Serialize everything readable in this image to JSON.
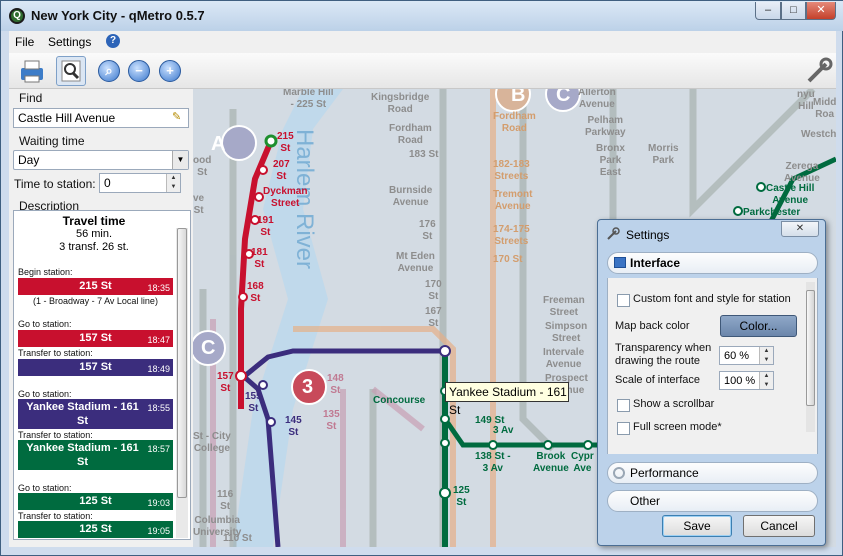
{
  "window": {
    "title": "New York City - qMetro 0.5.7",
    "app_icon": "qmetro-logo-icon",
    "minimize": "–",
    "maximize": "□",
    "close": "✕"
  },
  "menu": {
    "file": "File",
    "settings": "Settings",
    "help_icon": "help-icon"
  },
  "toolbar": {
    "print": "printer-icon",
    "find": "find-icon",
    "zoom_fit": "zoom-fit-icon",
    "zoom_out": "zoom-out-icon",
    "zoom_in": "zoom-in-icon",
    "tools": "tools-icon"
  },
  "find": {
    "label": "Find",
    "value": "Castle Hill Avenue"
  },
  "waiting": {
    "label": "Waiting time",
    "value": "Day",
    "time_label": "Time to station:",
    "time_value": "0"
  },
  "description": {
    "label": "Description",
    "heading": "Travel time",
    "duration": "56 min.",
    "summary": "3 transf. 26 st.",
    "begin_label": "Begin station:",
    "begin_station": "215 St",
    "begin_time": "18:35",
    "begin_line": "(1 - Broadway - 7 Av Local line)",
    "goto1_label": "Go to station:",
    "goto1_station": "157 St",
    "goto1_time": "18:47",
    "transfer1_label": "Transfer to station:",
    "transfer1_station": "157 St",
    "transfer1_time": "18:49",
    "goto2_label": "Go to station:",
    "goto2_station": "Yankee Stadium - 161 St",
    "goto2_time": "18:55",
    "transfer2_label": "Transfer to station:",
    "transfer2_station": "Yankee Stadium - 161 St",
    "transfer2_time": "18:57",
    "goto3_label": "Go to station:",
    "goto3_station": "125 St",
    "goto3_time": "19:03",
    "transfer3_label": "Transfer to station:",
    "transfer3_station": "125 St",
    "transfer3_time": "19:05"
  },
  "colors": {
    "red_line": "#c8102e",
    "purple_line": "#3b2d7d",
    "green_line": "#006b3f"
  },
  "map": {
    "river": "Harlem River",
    "lines": [
      "A",
      "B",
      "C",
      "C",
      "3"
    ],
    "labels": {
      "marble_hill": "Marble Hill\n- 225 St",
      "kingsbridge": "Kingsbridge\nRoad",
      "fordham1": "Fordham\nRoad",
      "st183": "183 St",
      "burnside": "Burnside\nAvenue",
      "st176": "176\nSt",
      "mt_eden": "Mt Eden\nAvenue",
      "st170": "170\nSt",
      "st167": "167\nSt",
      "st161": "161\nSt",
      "fordham2": "Fordham\nRoad",
      "st182": "182-183\nStreets",
      "tremont": "Tremont\nAvenue",
      "st174": "174-175\nStreets",
      "st170b": "170 St",
      "allerton": "Allerton\nAvenue",
      "pelham": "Pelham\nParkway",
      "bronx_park": "Bronx\nPark\nEast",
      "morris": "Morris\nPark",
      "freeman": "Freeman\nStreet",
      "simpson": "Simpson\nStreet",
      "intervale": "Intervale\nAvenue",
      "prospect": "Prospect\nAvenue",
      "st215": "215\nSt",
      "st207": "207\nSt",
      "dyckman": "Dyckman\nStreet",
      "st191": "191\nSt",
      "st181": "181\nSt",
      "st168": "168\nSt",
      "st157": "157\nSt",
      "st155": "155\nSt",
      "st145": "145\nSt",
      "st148": "148\nSt",
      "st135": "135\nSt",
      "concourse": "Concourse",
      "st149": "149 St",
      "st3av": "3 Av",
      "st138": "138 St -\n3 Av",
      "brook": "Brook\nAvenue",
      "cypress": "Cypr\nAve",
      "st125": "125\nSt",
      "castle": "Castle Hill\nAvenue",
      "parkchester": "Parkchester",
      "zerega": "Zerega\nAvenue",
      "westchester": "Westchester",
      "middletown": "Midd\nRoa",
      "bx_city": "St - City\nCollege",
      "st116": "116\nSt",
      "columbia": "Columbia\nUniversity",
      "st110": "110 St",
      "nyu": "nyu\nHill",
      "ood": "ood\nSt",
      "ve": "ve\nSt"
    }
  },
  "tooltip": "Yankee Stadium - 161 St",
  "settings": {
    "title": "Settings",
    "close": "✕",
    "interface_tab": "Interface",
    "custom_font": "Custom font and style for station",
    "back_color_label": "Map back color",
    "color_button": "Color...",
    "transparency_label": "Transparency when drawing the route",
    "transparency_value": "60 %",
    "scale_label": "Scale of interface",
    "scale_value": "100 %",
    "scrollbar_label": "Show a scrollbar",
    "fullscreen_label": "Full screen mode*",
    "performance_tab": "Performance",
    "other_tab": "Other",
    "save": "Save",
    "cancel": "Cancel"
  }
}
